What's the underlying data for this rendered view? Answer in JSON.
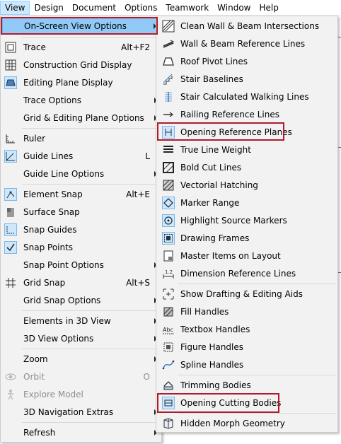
{
  "menubar": {
    "items": [
      "View",
      "Design",
      "Document",
      "Options",
      "Teamwork",
      "Window",
      "Help"
    ]
  },
  "view_menu": {
    "items": [
      {
        "label": "On-Screen View Options",
        "shortcut": "",
        "submenu": true,
        "icon": "none",
        "state": "highlighted"
      },
      {
        "label": "Trace",
        "shortcut": "Alt+F2",
        "submenu": false,
        "icon": "trace-icon"
      },
      {
        "label": "Construction Grid Display",
        "shortcut": "",
        "submenu": false,
        "icon": "grid-icon"
      },
      {
        "label": "Editing Plane Display",
        "shortcut": "",
        "submenu": false,
        "icon": "editing-plane-icon"
      },
      {
        "label": "Trace Options",
        "shortcut": "",
        "submenu": true
      },
      {
        "label": "Grid & Editing Plane Options",
        "shortcut": "",
        "submenu": true
      },
      {
        "label": "Ruler",
        "shortcut": "",
        "submenu": false,
        "icon": "ruler-icon"
      },
      {
        "label": "Guide Lines",
        "shortcut": "L",
        "submenu": false,
        "icon": "guide-lines-icon"
      },
      {
        "label": "Guide Line Options",
        "shortcut": "",
        "submenu": true
      },
      {
        "label": "Element Snap",
        "shortcut": "Alt+E",
        "submenu": false,
        "icon": "element-snap-icon"
      },
      {
        "label": "Surface Snap",
        "shortcut": "",
        "submenu": false,
        "icon": "surface-snap-icon"
      },
      {
        "label": "Snap Guides",
        "shortcut": "",
        "submenu": false,
        "icon": "snap-guides-icon"
      },
      {
        "label": "Snap Points",
        "shortcut": "",
        "submenu": false,
        "icon": "snap-points-icon"
      },
      {
        "label": "Snap Point Options",
        "shortcut": "",
        "submenu": true
      },
      {
        "label": "Grid Snap",
        "shortcut": "Alt+S",
        "submenu": false,
        "icon": "grid-snap-icon"
      },
      {
        "label": "Grid Snap Options",
        "shortcut": "",
        "submenu": true
      },
      {
        "label": "Elements in 3D View",
        "shortcut": "",
        "submenu": true
      },
      {
        "label": "3D View Options",
        "shortcut": "",
        "submenu": true
      },
      {
        "label": "Zoom",
        "shortcut": "",
        "submenu": true
      },
      {
        "label": "Orbit",
        "shortcut": "O",
        "submenu": false,
        "icon": "orbit-icon",
        "state": "disabled"
      },
      {
        "label": "Explore Model",
        "shortcut": "",
        "submenu": false,
        "icon": "explore-model-icon",
        "state": "disabled"
      },
      {
        "label": "3D Navigation Extras",
        "shortcut": "",
        "submenu": true
      },
      {
        "label": "Refresh",
        "shortcut": "",
        "submenu": true
      }
    ]
  },
  "submenu": {
    "items": [
      {
        "label": "Clean Wall & Beam Intersections",
        "icon": "clean-intersections-icon"
      },
      {
        "label": "Wall & Beam Reference Lines",
        "icon": "reference-lines-icon"
      },
      {
        "label": "Roof Pivot Lines",
        "icon": "roof-pivot-icon"
      },
      {
        "label": "Stair Baselines",
        "icon": "stair-baselines-icon"
      },
      {
        "label": "Stair Calculated Walking Lines",
        "icon": "walking-lines-icon"
      },
      {
        "label": "Railing Reference Lines",
        "icon": "railing-lines-icon"
      },
      {
        "label": "Opening Reference Planes",
        "icon": "opening-planes-icon",
        "annotated": true
      },
      {
        "label": "True Line Weight",
        "icon": "line-weight-icon"
      },
      {
        "label": "Bold Cut Lines",
        "icon": "bold-cut-icon"
      },
      {
        "label": "Vectorial Hatching",
        "icon": "hatching-icon"
      },
      {
        "label": "Marker Range",
        "icon": "marker-range-icon"
      },
      {
        "label": "Highlight Source Markers",
        "icon": "source-markers-icon"
      },
      {
        "label": "Drawing Frames",
        "icon": "drawing-frames-icon"
      },
      {
        "label": "Master Items on Layout",
        "icon": "master-items-icon"
      },
      {
        "label": "Dimension Reference Lines",
        "icon": "dimension-lines-icon"
      },
      {
        "label": "Show Drafting & Editing Aids",
        "icon": "drafting-aids-icon"
      },
      {
        "label": "Fill Handles",
        "icon": "fill-handles-icon"
      },
      {
        "label": "Textbox Handles",
        "icon": "textbox-handles-icon"
      },
      {
        "label": "Figure Handles",
        "icon": "figure-handles-icon"
      },
      {
        "label": "Spline Handles",
        "icon": "spline-handles-icon"
      },
      {
        "label": "Trimming Bodies",
        "icon": "trimming-bodies-icon"
      },
      {
        "label": "Opening Cutting Bodies",
        "icon": "cutting-bodies-icon",
        "annotated": true
      },
      {
        "label": "Hidden Morph Geometry",
        "icon": "morph-geometry-icon"
      }
    ]
  },
  "colors": {
    "menu_bg": "#f2f2f2",
    "highlight": "#91c9f7",
    "annotation": "#b01c2e",
    "icon_active_bg": "#cfe7fb"
  }
}
